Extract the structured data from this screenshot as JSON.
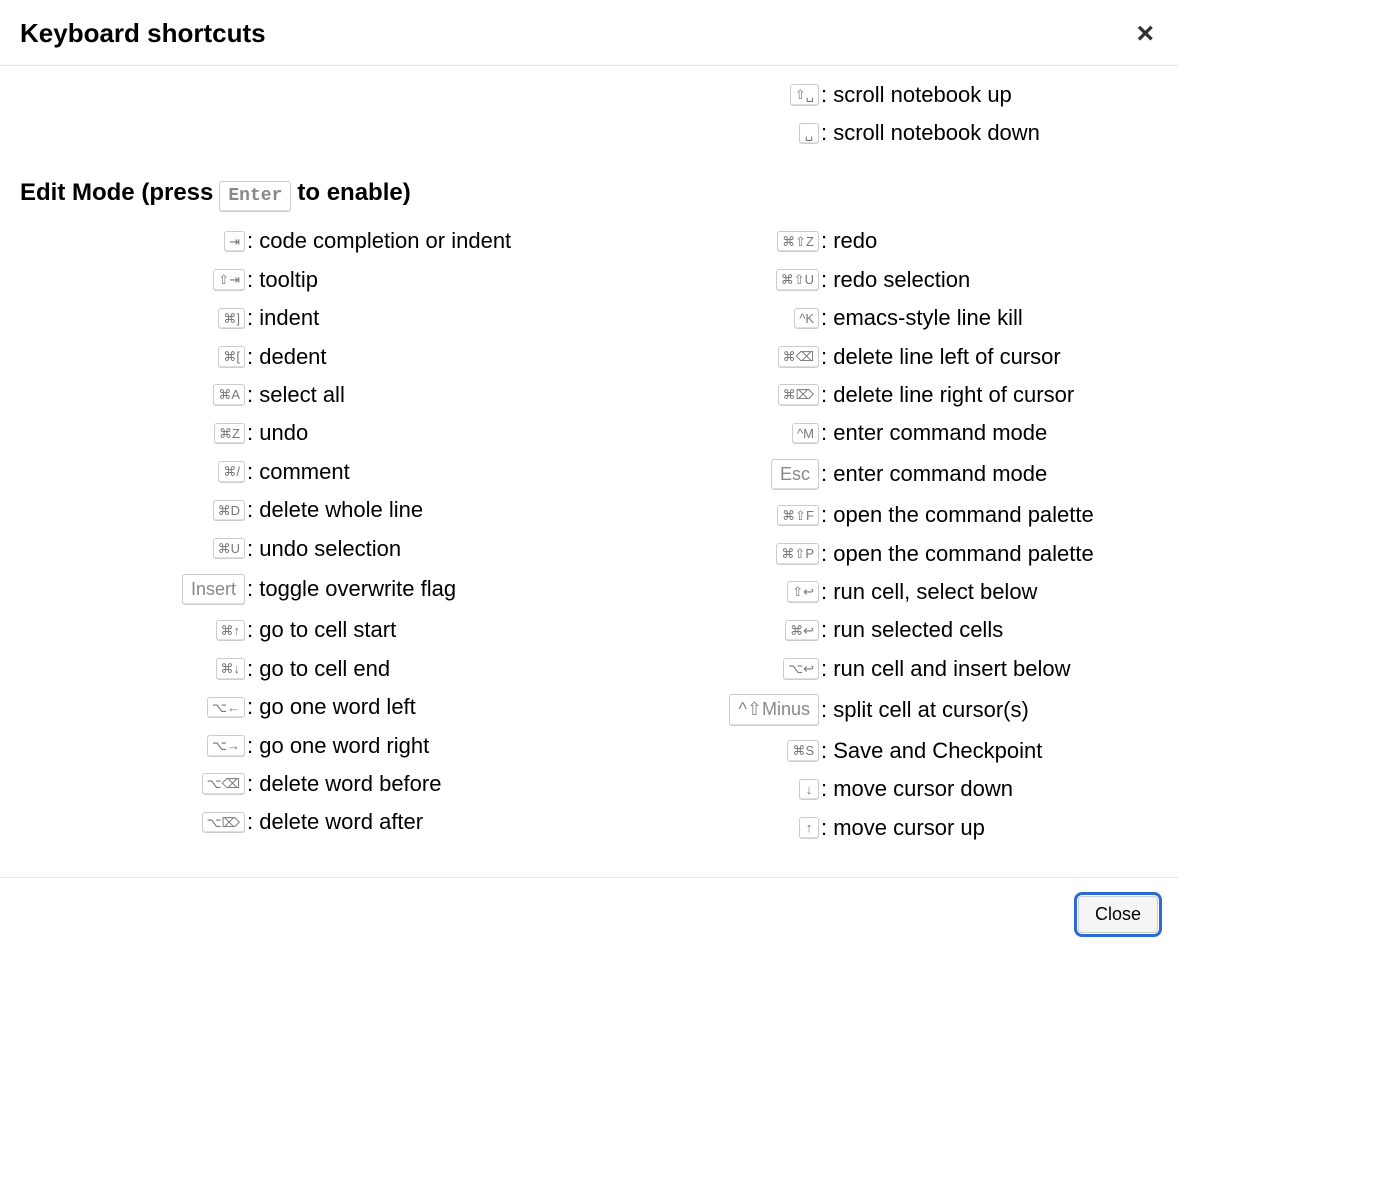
{
  "header": {
    "title": "Keyboard shortcuts",
    "close_x": "×"
  },
  "top_right": [
    {
      "keys": "⇧␣",
      "desc": "scroll notebook up"
    },
    {
      "keys": "␣",
      "desc": "scroll notebook down"
    }
  ],
  "edit_mode": {
    "title_prefix": "Edit Mode (press ",
    "title_key": "Enter",
    "title_suffix": " to enable)",
    "left": [
      {
        "keys": "⇥",
        "desc": "code completion or indent"
      },
      {
        "keys": "⇧⇥",
        "desc": "tooltip"
      },
      {
        "keys": "⌘]",
        "desc": "indent"
      },
      {
        "keys": "⌘[",
        "desc": "dedent"
      },
      {
        "keys": "⌘A",
        "desc": "select all"
      },
      {
        "keys": "⌘Z",
        "desc": "undo"
      },
      {
        "keys": "⌘/",
        "desc": "comment"
      },
      {
        "keys": "⌘D",
        "desc": "delete whole line"
      },
      {
        "keys": "⌘U",
        "desc": "undo selection"
      },
      {
        "keys": "Insert",
        "big": true,
        "desc": "toggle overwrite flag"
      },
      {
        "keys": "⌘↑",
        "desc": "go to cell start"
      },
      {
        "keys": "⌘↓",
        "desc": "go to cell end"
      },
      {
        "keys": "⌥←",
        "desc": "go one word left"
      },
      {
        "keys": "⌥→",
        "desc": "go one word right"
      },
      {
        "keys": "⌥⌫",
        "desc": "delete word before"
      },
      {
        "keys": "⌥⌦",
        "desc": "delete word after"
      }
    ],
    "right": [
      {
        "keys": "⌘⇧Z",
        "desc": "redo"
      },
      {
        "keys": "⌘⇧U",
        "desc": "redo selection"
      },
      {
        "keys": "^K",
        "desc": "emacs-style line kill"
      },
      {
        "keys": "⌘⌫",
        "desc": "delete line left of cursor"
      },
      {
        "keys": "⌘⌦",
        "desc": "delete line right of cursor"
      },
      {
        "keys": "^M",
        "desc": "enter command mode"
      },
      {
        "keys": "Esc",
        "big": true,
        "desc": "enter command mode"
      },
      {
        "keys": "⌘⇧F",
        "desc": "open the command palette"
      },
      {
        "keys": "⌘⇧P",
        "desc": "open the command palette"
      },
      {
        "keys": "⇧↩",
        "desc": "run cell, select below"
      },
      {
        "keys": "⌘↩",
        "desc": "run selected cells"
      },
      {
        "keys": "⌥↩",
        "desc": "run cell and insert below"
      },
      {
        "keys": "^⇧Minus",
        "big": true,
        "desc": "split cell at cursor(s)"
      },
      {
        "keys": "⌘S",
        "desc": "Save and Checkpoint"
      },
      {
        "keys": "↓",
        "desc": "move cursor down"
      },
      {
        "keys": "↑",
        "desc": "move cursor up"
      }
    ]
  },
  "footer": {
    "close_label": "Close"
  }
}
